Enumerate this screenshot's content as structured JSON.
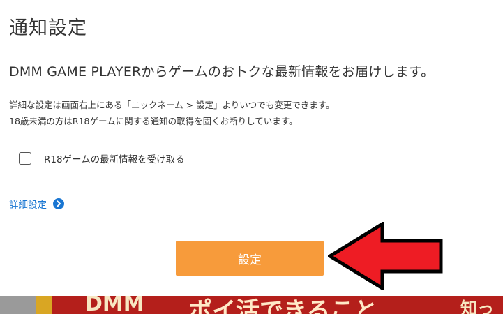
{
  "dialog": {
    "title": "通知設定",
    "lead": "DMM GAME PLAYERからゲームのおトクな最新情報をお届けします。",
    "notes": [
      "詳細な設定は画面右上にある「ニックネーム > 設定」よりいつでも変更できます。",
      "18歳未満の方はR18ゲームに関する通知の取得を固くお断りしています。"
    ],
    "r18_checkbox": {
      "label": "R18ゲームの最新情報を受け取る",
      "checked": false
    },
    "detail_link": {
      "label": "詳細設定",
      "icon": "chevron-right-circle-icon",
      "color": "#1976d2"
    },
    "submit_button": {
      "label": "設定",
      "color": "#f79b3b"
    }
  },
  "annotation": {
    "arrow_color": "#ee1c24",
    "arrow_direction": "left"
  },
  "banner": {
    "text_left": "DMM",
    "text_center": "ポイ活できること",
    "text_right": "知っ",
    "background": "#b41f1b"
  }
}
